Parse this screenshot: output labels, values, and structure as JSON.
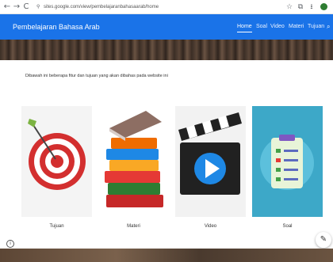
{
  "browser": {
    "back": "←",
    "forward": "→",
    "reload": "C",
    "url": "sites.google.com/view/pembelajaranbahasaarab/home",
    "star": "☆",
    "extensions": "⧉",
    "download": "⭳"
  },
  "site": {
    "title": "Pembelajaran Bahasa Arab",
    "menu": [
      "Home",
      "Soal",
      "Video",
      "Materi",
      "Tujuan"
    ],
    "search_icon": "search-icon"
  },
  "intro": "Dibawah ini beberapa fitur dan tujuan yang akan dibahas pada website ini",
  "cards": [
    {
      "label": "Tujuan",
      "icon": "target-icon"
    },
    {
      "label": "Materi",
      "icon": "books-icon"
    },
    {
      "label": "Video",
      "icon": "clapperboard-icon"
    },
    {
      "label": "Soal",
      "icon": "quiz-document-icon"
    }
  ],
  "colors": {
    "header": "#1a73e8",
    "quiz_bg": "#3da8c8"
  }
}
